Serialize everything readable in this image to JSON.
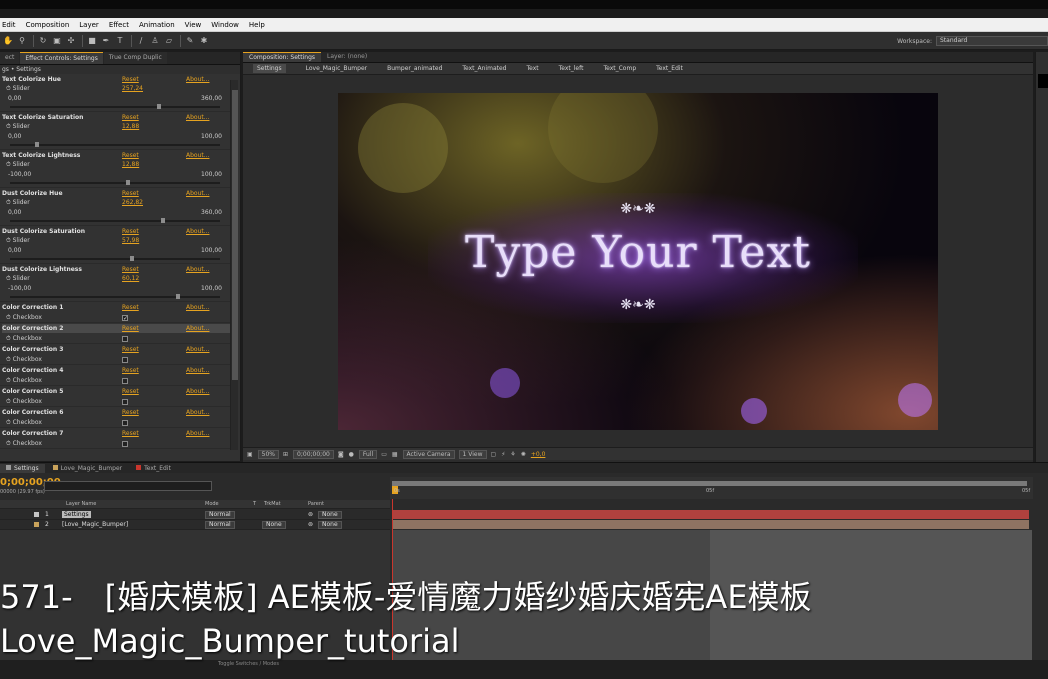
{
  "menu": [
    "Edit",
    "Composition",
    "Layer",
    "Effect",
    "Animation",
    "View",
    "Window",
    "Help"
  ],
  "workspace": {
    "label": "Workspace:",
    "value": "Standard"
  },
  "effect_controls": {
    "tabs": [
      "ect",
      "Effect Controls: Settings",
      "True Comp Duplic"
    ],
    "breadcrumb": "gs • Settings",
    "props": [
      {
        "name": "Text Colorize Hue",
        "reset": "Reset",
        "about": "About...",
        "sub": "Slider",
        "value": "257,24",
        "min": "0,00",
        "max": "360,00",
        "knob": 0.71
      },
      {
        "name": "Text Colorize Saturation",
        "reset": "Reset",
        "about": "About...",
        "sub": "Slider",
        "value": "12,88",
        "min": "0,00",
        "max": "100,00",
        "knob": 0.13
      },
      {
        "name": "Text Colorize Lightness",
        "reset": "Reset",
        "about": "About...",
        "sub": "Slider",
        "value": "12,88",
        "min": "-100,00",
        "max": "100,00",
        "knob": 0.56
      },
      {
        "name": "Dust Colorize Hue",
        "reset": "Reset",
        "about": "About...",
        "sub": "Slider",
        "value": "262,82",
        "min": "0,00",
        "max": "360,00",
        "knob": 0.73
      },
      {
        "name": "Dust Colorize Saturation",
        "reset": "Reset",
        "about": "About...",
        "sub": "Slider",
        "value": "57,98",
        "min": "0,00",
        "max": "100,00",
        "knob": 0.58
      },
      {
        "name": "Dust Colorize Lightness",
        "reset": "Reset",
        "about": "About...",
        "sub": "Slider",
        "value": "60,12",
        "min": "-100,00",
        "max": "100,00",
        "knob": 0.8
      }
    ],
    "checks": [
      {
        "name": "Color Correction 1",
        "reset": "Reset",
        "about": "About...",
        "sub": "Checkbox",
        "checked": true
      },
      {
        "name": "Color Correction 2",
        "reset": "Reset",
        "about": "About...",
        "sub": "Checkbox",
        "checked": false
      },
      {
        "name": "Color Correction 3",
        "reset": "Reset",
        "about": "About...",
        "sub": "Checkbox",
        "checked": false
      },
      {
        "name": "Color Correction 4",
        "reset": "Reset",
        "about": "About...",
        "sub": "Checkbox",
        "checked": false
      },
      {
        "name": "Color Correction 5",
        "reset": "Reset",
        "about": "About...",
        "sub": "Checkbox",
        "checked": false
      },
      {
        "name": "Color Correction 6",
        "reset": "Reset",
        "about": "About...",
        "sub": "Checkbox",
        "checked": false
      },
      {
        "name": "Color Correction 7",
        "reset": "Reset",
        "about": "About...",
        "sub": "Checkbox",
        "checked": false
      }
    ]
  },
  "composition": {
    "tabs": [
      "Composition: Settings",
      "Layer: (none)"
    ],
    "breadcrumbs": [
      "Settings",
      "Love_Magic_Bumper",
      "Bumper_animated",
      "Text_Animated",
      "Text",
      "Text_left",
      "Text_Comp",
      "Text_Edit"
    ],
    "viewer_text": "Type Your Text",
    "ornament": "❋❧❋",
    "footer": {
      "zoom": "50%",
      "timecode": "0;00;00;00",
      "resolution": "Full",
      "camera": "Active Camera",
      "views": "1 View",
      "exposure": "+0,0"
    }
  },
  "timeline": {
    "tabs": [
      {
        "label": "Settings",
        "color": "#9a9a9a"
      },
      {
        "label": "Love_Magic_Bumper",
        "color": "#c9a35b"
      },
      {
        "label": "Text_Edit",
        "color": "#c9362d"
      }
    ],
    "timecode": "0;00;00;00",
    "fps": "00000 (29.97 fps)",
    "headers": {
      "layer_name": "Layer Name",
      "mode": "Mode",
      "t": "T",
      "trkmat": "TrkMat",
      "parent": "Parent"
    },
    "layers": [
      {
        "num": "1",
        "name": "Settings",
        "mode": "Normal",
        "trkmat": "",
        "parent": "None",
        "color": "#c5c5c5",
        "bar": "#b0413e"
      },
      {
        "num": "2",
        "name": "[Love_Magic_Bumper]",
        "mode": "Normal",
        "trkmat": "None",
        "parent": "None",
        "color": "#c9a35b",
        "bar": "#8f7362"
      }
    ],
    "ruler_labels": [
      "0s",
      "05f",
      "05f"
    ],
    "toggle": "Toggle Switches / Modes"
  },
  "caption": {
    "line1": "571-　[婚庆模板] AE模板-爱情魔力婚纱婚庆婚宪AE模板",
    "line2": "Love_Magic_Bumper_tutorial"
  },
  "colors": {
    "accent": "#e6a320",
    "cti": "#c9362d",
    "viewer_glow": "#8c46d2"
  }
}
